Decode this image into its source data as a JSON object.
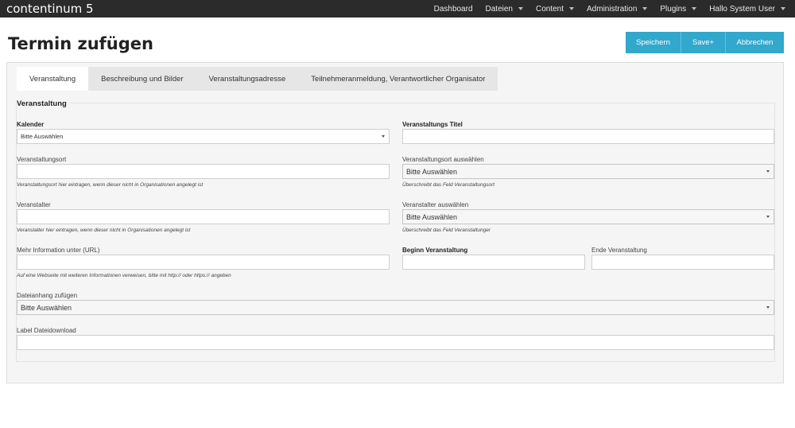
{
  "app": {
    "brand": "contentinum 5"
  },
  "nav": {
    "dashboard": "Dashboard",
    "dateien": "Dateien",
    "content": "Content",
    "administration": "Administration",
    "plugins": "Plugins",
    "user": "Hallo System User"
  },
  "page": {
    "title": "Termin zufügen"
  },
  "actions": {
    "save": "Speichern",
    "save_plus": "Save+",
    "cancel": "Abbrechen"
  },
  "tabs": [
    {
      "label": "Veranstaltung"
    },
    {
      "label": "Beschreibung und Bilder"
    },
    {
      "label": "Veranstaltungsadresse"
    },
    {
      "label": "Teilnehmeranmeldung, Verantwortlicher Organisator"
    }
  ],
  "form": {
    "legend": "Veranstaltung",
    "kalender": {
      "label": "Kalender",
      "value": "Bitte Auswählen"
    },
    "titel": {
      "label": "Veranstaltungs Titel",
      "value": ""
    },
    "ort": {
      "label": "Veranstaltungsort",
      "value": "",
      "hint": "Veranstaltungsort hier eintragen, wenn dieser nicht in Organisationen angelegt ist"
    },
    "ort_select": {
      "label": "Veranstaltungsort auswählen",
      "value": "Bitte Auswählen",
      "hint": "Überschreibt das Feld Veranstaltungsort"
    },
    "veranstalter": {
      "label": "Veranstalter",
      "value": "",
      "hint": "Veranstalter hier eintragen, wenn dieser nicht in Organisationen angelegt ist"
    },
    "veranstalter_select": {
      "label": "Veranstalter auswählen",
      "value": "Bitte Auswählen",
      "hint": "Überschreibt das Feld Veranstaltunger"
    },
    "url": {
      "label": "Mehr Information unter (URL)",
      "value": "",
      "hint": "Auf eine Webseite mit weiteren Informationen verweisen, bitte mit http:// oder https:// angeben"
    },
    "beginn": {
      "label": "Beginn Veranstaltung",
      "value": ""
    },
    "ende": {
      "label": "Ende Veranstaltung",
      "value": ""
    },
    "anhang": {
      "label": "Dateianhang zufügen",
      "value": "Bitte Auswählen"
    },
    "label_download": {
      "label": "Label Dateidownload",
      "value": ""
    }
  }
}
